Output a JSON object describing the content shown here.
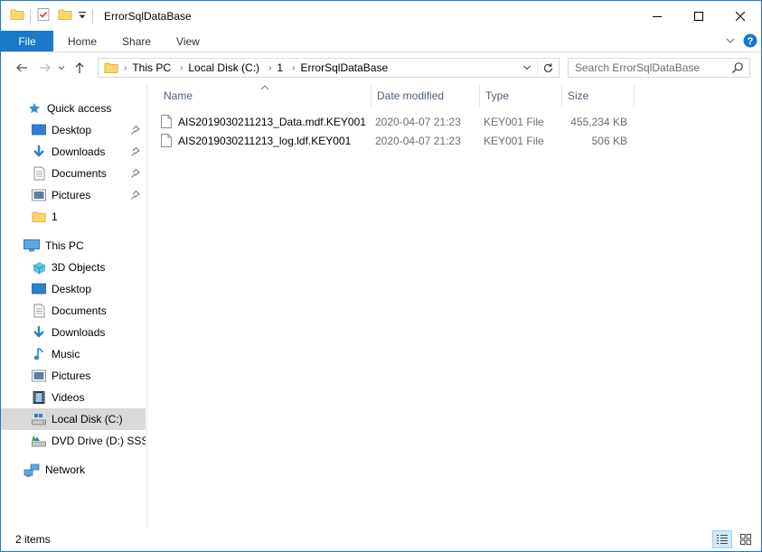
{
  "window": {
    "title": "ErrorSqlDataBase"
  },
  "ribbon": {
    "tabs": [
      {
        "label": "File"
      },
      {
        "label": "Home"
      },
      {
        "label": "Share"
      },
      {
        "label": "View"
      }
    ]
  },
  "address": {
    "crumbs": [
      "This PC",
      "Local Disk (C:)",
      "1",
      "ErrorSqlDataBase"
    ]
  },
  "search": {
    "placeholder": "Search ErrorSqlDataBase"
  },
  "nav": {
    "quick_access": "Quick access",
    "qa_items": [
      "Desktop",
      "Downloads",
      "Documents",
      "Pictures",
      "1"
    ],
    "this_pc": "This PC",
    "pc_items": [
      "3D Objects",
      "Desktop",
      "Documents",
      "Downloads",
      "Music",
      "Pictures",
      "Videos",
      "Local Disk (C:)",
      "DVD Drive (D:) SSS_X"
    ],
    "network": "Network"
  },
  "columns": {
    "name": "Name",
    "date": "Date modified",
    "type": "Type",
    "size": "Size"
  },
  "files": [
    {
      "name": "AIS2019030211213_Data.mdf.KEY001",
      "date": "2020-04-07 21:23",
      "type": "KEY001 File",
      "size": "455,234 KB"
    },
    {
      "name": "AIS2019030211213_log.ldf.KEY001",
      "date": "2020-04-07 21:23",
      "type": "KEY001 File",
      "size": "506 KB"
    }
  ],
  "status": {
    "items": "2 items"
  },
  "colors": {
    "accent": "#1979ca",
    "selected_nav": "#d9d9d9",
    "header_text": "#4c607a"
  }
}
